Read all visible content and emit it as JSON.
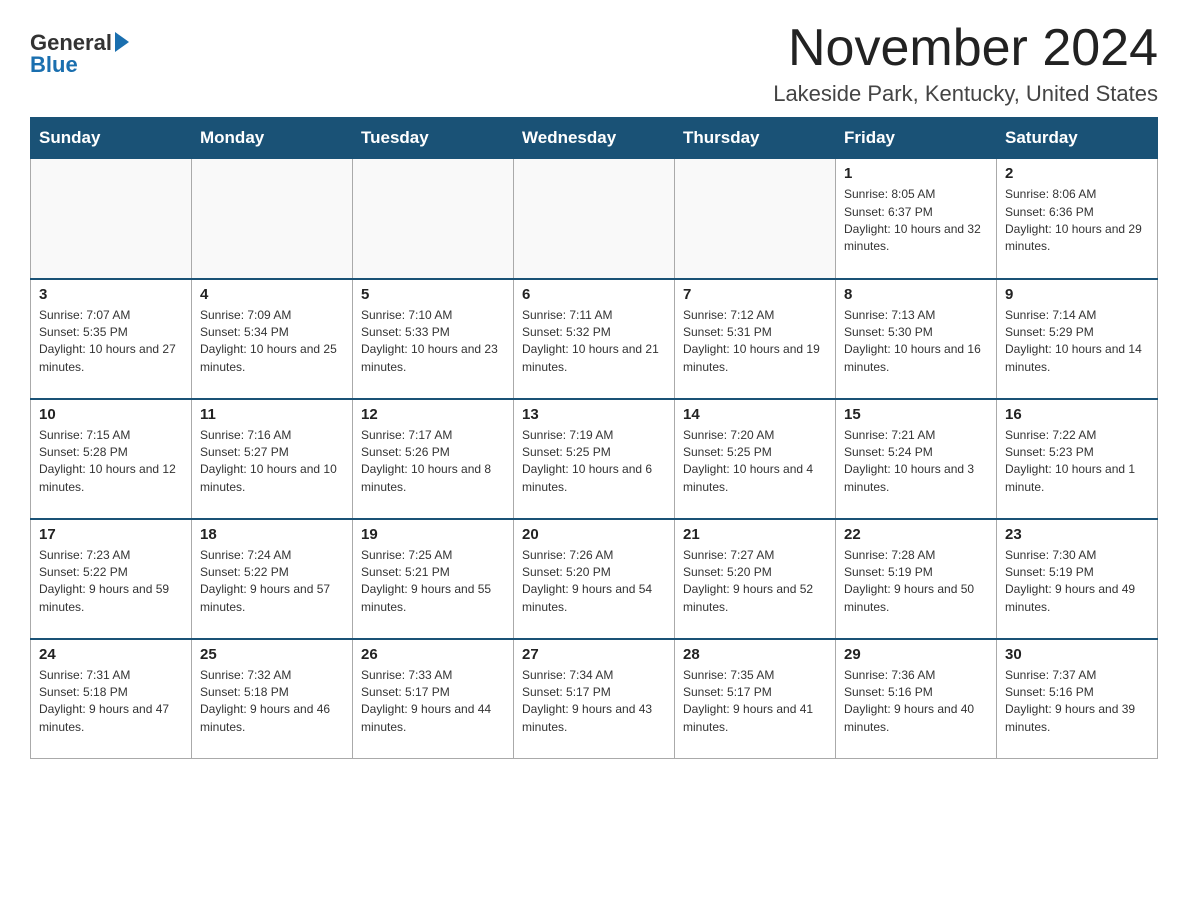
{
  "header": {
    "logo_general": "General",
    "logo_blue": "Blue",
    "month_title": "November 2024",
    "location": "Lakeside Park, Kentucky, United States"
  },
  "weekdays": [
    "Sunday",
    "Monday",
    "Tuesday",
    "Wednesday",
    "Thursday",
    "Friday",
    "Saturday"
  ],
  "weeks": [
    [
      {
        "day": "",
        "info": ""
      },
      {
        "day": "",
        "info": ""
      },
      {
        "day": "",
        "info": ""
      },
      {
        "day": "",
        "info": ""
      },
      {
        "day": "",
        "info": ""
      },
      {
        "day": "1",
        "info": "Sunrise: 8:05 AM\nSunset: 6:37 PM\nDaylight: 10 hours and 32 minutes."
      },
      {
        "day": "2",
        "info": "Sunrise: 8:06 AM\nSunset: 6:36 PM\nDaylight: 10 hours and 29 minutes."
      }
    ],
    [
      {
        "day": "3",
        "info": "Sunrise: 7:07 AM\nSunset: 5:35 PM\nDaylight: 10 hours and 27 minutes."
      },
      {
        "day": "4",
        "info": "Sunrise: 7:09 AM\nSunset: 5:34 PM\nDaylight: 10 hours and 25 minutes."
      },
      {
        "day": "5",
        "info": "Sunrise: 7:10 AM\nSunset: 5:33 PM\nDaylight: 10 hours and 23 minutes."
      },
      {
        "day": "6",
        "info": "Sunrise: 7:11 AM\nSunset: 5:32 PM\nDaylight: 10 hours and 21 minutes."
      },
      {
        "day": "7",
        "info": "Sunrise: 7:12 AM\nSunset: 5:31 PM\nDaylight: 10 hours and 19 minutes."
      },
      {
        "day": "8",
        "info": "Sunrise: 7:13 AM\nSunset: 5:30 PM\nDaylight: 10 hours and 16 minutes."
      },
      {
        "day": "9",
        "info": "Sunrise: 7:14 AM\nSunset: 5:29 PM\nDaylight: 10 hours and 14 minutes."
      }
    ],
    [
      {
        "day": "10",
        "info": "Sunrise: 7:15 AM\nSunset: 5:28 PM\nDaylight: 10 hours and 12 minutes."
      },
      {
        "day": "11",
        "info": "Sunrise: 7:16 AM\nSunset: 5:27 PM\nDaylight: 10 hours and 10 minutes."
      },
      {
        "day": "12",
        "info": "Sunrise: 7:17 AM\nSunset: 5:26 PM\nDaylight: 10 hours and 8 minutes."
      },
      {
        "day": "13",
        "info": "Sunrise: 7:19 AM\nSunset: 5:25 PM\nDaylight: 10 hours and 6 minutes."
      },
      {
        "day": "14",
        "info": "Sunrise: 7:20 AM\nSunset: 5:25 PM\nDaylight: 10 hours and 4 minutes."
      },
      {
        "day": "15",
        "info": "Sunrise: 7:21 AM\nSunset: 5:24 PM\nDaylight: 10 hours and 3 minutes."
      },
      {
        "day": "16",
        "info": "Sunrise: 7:22 AM\nSunset: 5:23 PM\nDaylight: 10 hours and 1 minute."
      }
    ],
    [
      {
        "day": "17",
        "info": "Sunrise: 7:23 AM\nSunset: 5:22 PM\nDaylight: 9 hours and 59 minutes."
      },
      {
        "day": "18",
        "info": "Sunrise: 7:24 AM\nSunset: 5:22 PM\nDaylight: 9 hours and 57 minutes."
      },
      {
        "day": "19",
        "info": "Sunrise: 7:25 AM\nSunset: 5:21 PM\nDaylight: 9 hours and 55 minutes."
      },
      {
        "day": "20",
        "info": "Sunrise: 7:26 AM\nSunset: 5:20 PM\nDaylight: 9 hours and 54 minutes."
      },
      {
        "day": "21",
        "info": "Sunrise: 7:27 AM\nSunset: 5:20 PM\nDaylight: 9 hours and 52 minutes."
      },
      {
        "day": "22",
        "info": "Sunrise: 7:28 AM\nSunset: 5:19 PM\nDaylight: 9 hours and 50 minutes."
      },
      {
        "day": "23",
        "info": "Sunrise: 7:30 AM\nSunset: 5:19 PM\nDaylight: 9 hours and 49 minutes."
      }
    ],
    [
      {
        "day": "24",
        "info": "Sunrise: 7:31 AM\nSunset: 5:18 PM\nDaylight: 9 hours and 47 minutes."
      },
      {
        "day": "25",
        "info": "Sunrise: 7:32 AM\nSunset: 5:18 PM\nDaylight: 9 hours and 46 minutes."
      },
      {
        "day": "26",
        "info": "Sunrise: 7:33 AM\nSunset: 5:17 PM\nDaylight: 9 hours and 44 minutes."
      },
      {
        "day": "27",
        "info": "Sunrise: 7:34 AM\nSunset: 5:17 PM\nDaylight: 9 hours and 43 minutes."
      },
      {
        "day": "28",
        "info": "Sunrise: 7:35 AM\nSunset: 5:17 PM\nDaylight: 9 hours and 41 minutes."
      },
      {
        "day": "29",
        "info": "Sunrise: 7:36 AM\nSunset: 5:16 PM\nDaylight: 9 hours and 40 minutes."
      },
      {
        "day": "30",
        "info": "Sunrise: 7:37 AM\nSunset: 5:16 PM\nDaylight: 9 hours and 39 minutes."
      }
    ]
  ]
}
